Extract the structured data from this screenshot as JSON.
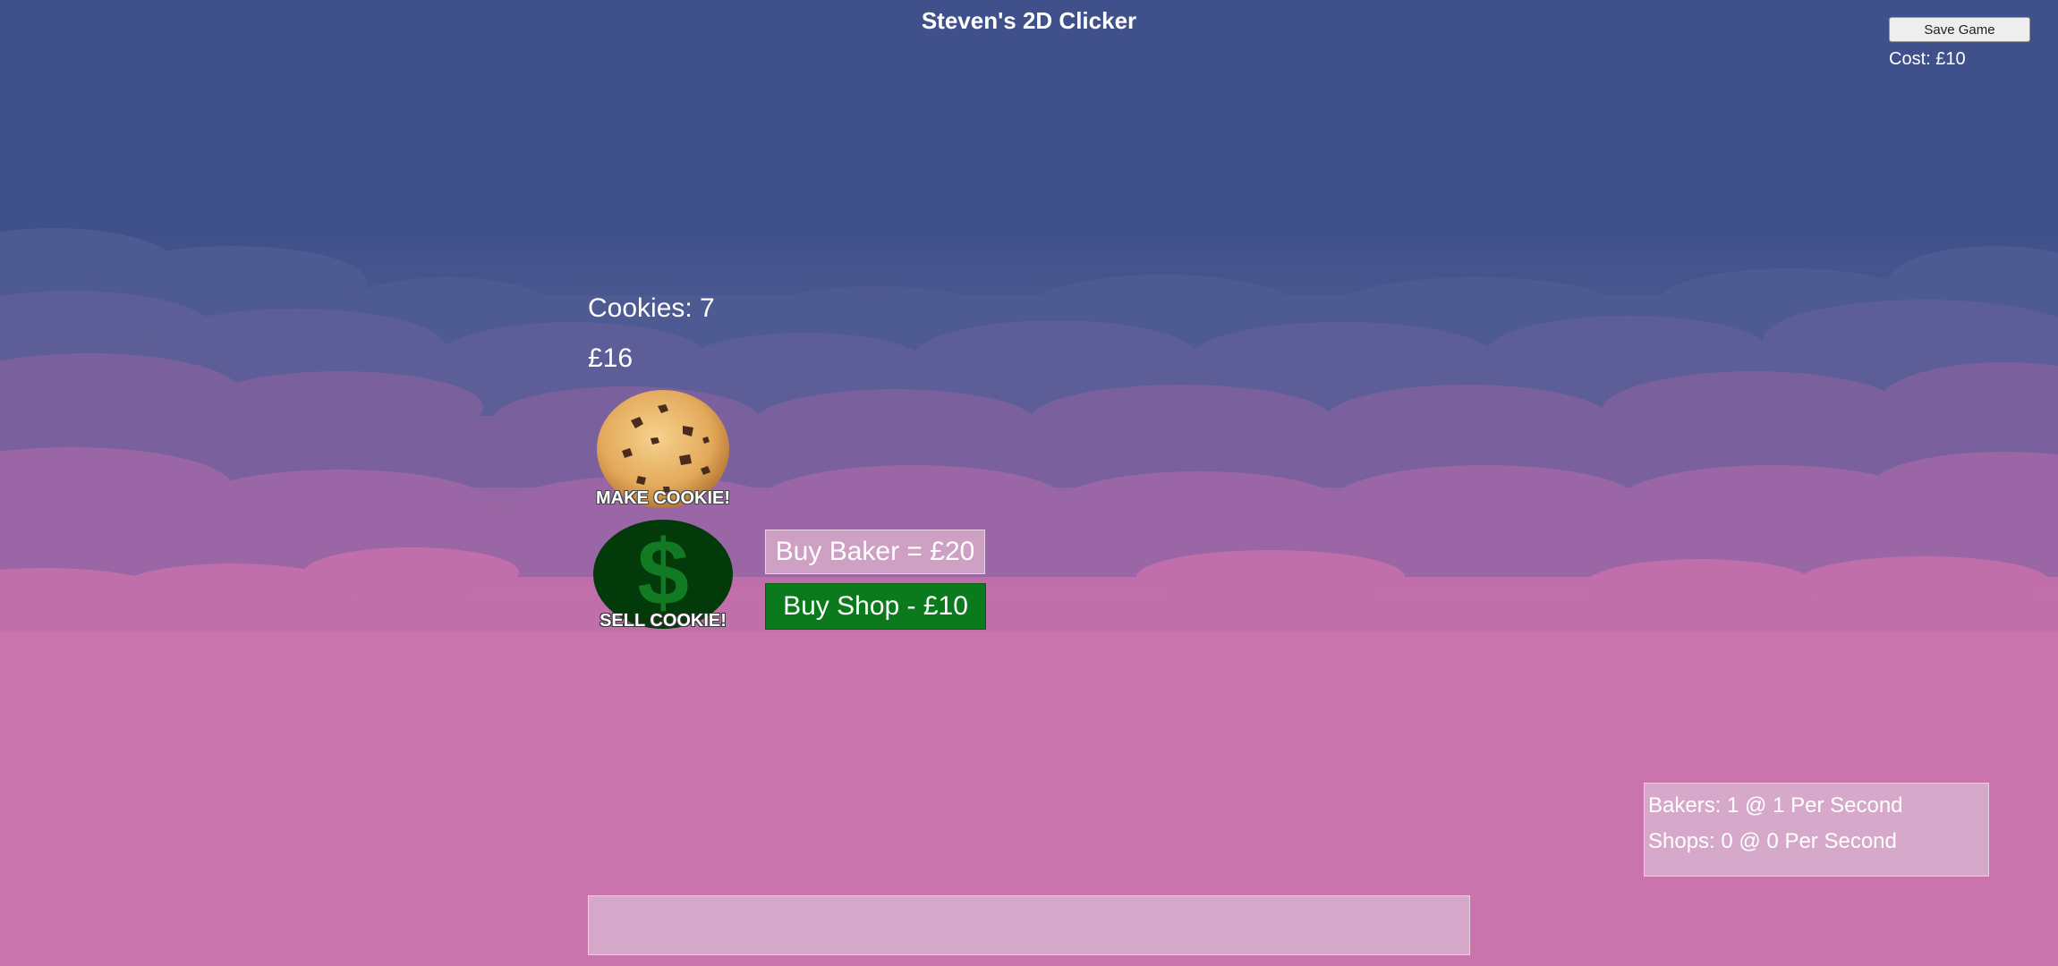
{
  "game": {
    "title": "Steven's 2D Clicker"
  },
  "toolbar": {
    "save_label": "Save Game",
    "cost_text": "Cost: £10"
  },
  "stats": {
    "cookies_text": "Cookies: 7",
    "money_text": "£16"
  },
  "actions": {
    "make_label": "MAKE COOKIE!",
    "sell_label": "SELL COOKIE!",
    "sell_icon": "$",
    "buy_baker_label": "Buy Baker = £20",
    "buy_shop_label": "Buy Shop - £10"
  },
  "production": {
    "bakers_text": "Bakers: 1 @ 1 Per Second",
    "shops_text": "Shops: 0 @ 0 Per Second"
  },
  "log": {
    "text": ""
  },
  "colors": {
    "sky_top": "#3f508b",
    "sky_bottom": "#c974ad",
    "shop_button": "#0a7a1c",
    "sell_button": "#033a0a"
  }
}
